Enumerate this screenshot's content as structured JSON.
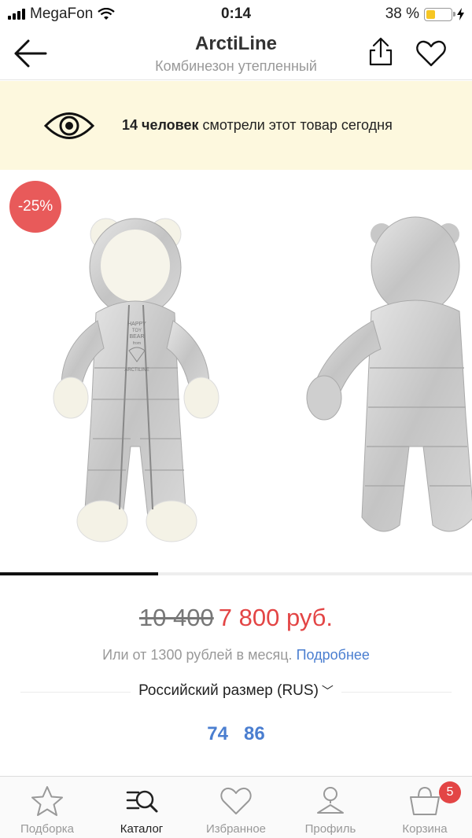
{
  "status_bar": {
    "carrier": "MegaFon",
    "time": "0:14",
    "battery_percent": "38 %",
    "battery_level": 0.38
  },
  "header": {
    "title": "ArctiLine",
    "subtitle": "Комбинезон утепленный",
    "back_icon": "arrow-left-icon",
    "share_icon": "share-icon",
    "favorite_icon": "heart-icon"
  },
  "banner": {
    "count_text": "14 человек",
    "rest_text": " смотрели этот товар сегодня",
    "icon": "eye-icon"
  },
  "gallery": {
    "discount": "-25%",
    "images": [
      "snowsuit-front",
      "snowsuit-back"
    ],
    "emblem_text": [
      "HAPPY",
      "TOY",
      "BEAR",
      "from",
      "ARCTILINE"
    ],
    "progress_fraction": 0.335
  },
  "price": {
    "old": "10 400",
    "new": "7 800 руб."
  },
  "installment": {
    "text": "Или от 1300 рублей в месяц. ",
    "link": "Подробнее"
  },
  "size": {
    "label": "Российский размер (RUS)",
    "chevron": "﹀",
    "options": [
      "74",
      "86"
    ]
  },
  "tabbar": {
    "tabs": [
      {
        "label": "Подборка",
        "icon": "star-icon"
      },
      {
        "label": "Каталог",
        "icon": "catalog-search-icon"
      },
      {
        "label": "Избранное",
        "icon": "heart-icon"
      },
      {
        "label": "Профиль",
        "icon": "profile-icon"
      },
      {
        "label": "Корзина",
        "icon": "basket-icon"
      }
    ],
    "active": "Каталог",
    "cart_count": "5"
  },
  "colors": {
    "accent_red": "#e34545",
    "link_blue": "#4a7ed0",
    "banner_bg": "#fdf8de",
    "discount_badge": "#e85a5a"
  }
}
